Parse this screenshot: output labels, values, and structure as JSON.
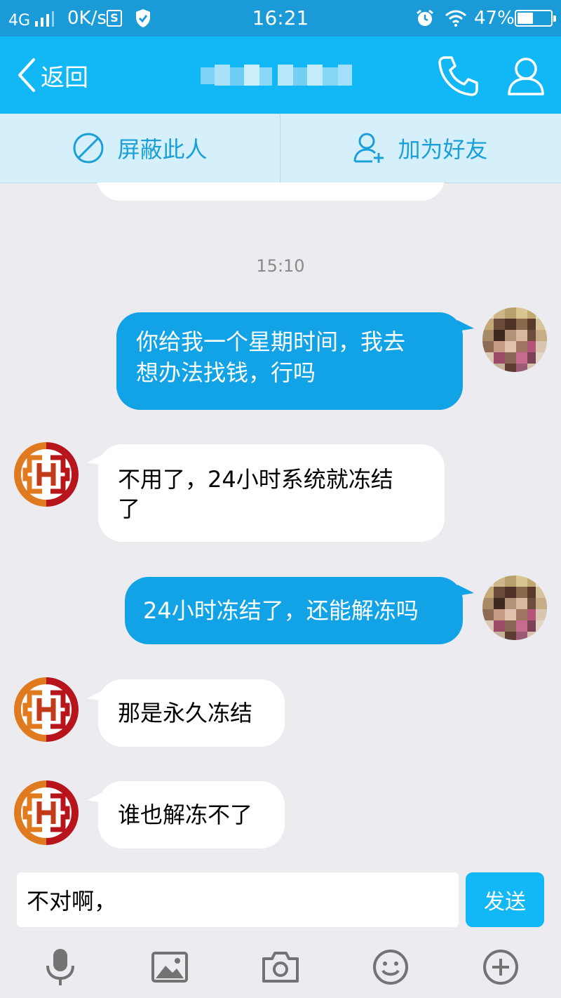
{
  "status_bar": {
    "network": "4G",
    "speed": "0K/s",
    "s_badge": "S",
    "time": "16:21",
    "battery": "47%",
    "battery_level": 0.47,
    "icons": [
      "signal-icon",
      "s-icon",
      "shield-icon",
      "alarm-icon",
      "wifi-icon",
      "battery-icon"
    ]
  },
  "header": {
    "back_label": "返回",
    "title_redacted": true,
    "icons": [
      "back-chevron-icon",
      "phone-icon",
      "profile-icon"
    ]
  },
  "actions": {
    "block_label": "屏蔽此人",
    "add_friend_label": "加为好友",
    "icons": [
      "block-icon",
      "add-friend-icon"
    ]
  },
  "chat": {
    "timestamp": "15:10",
    "messages": [
      {
        "sender": "me",
        "lines": [
          "你给我一个星期时间，我去",
          "想办法找钱，行吗"
        ]
      },
      {
        "sender": "them",
        "lines": [
          "不用了，24小时系统就冻结",
          "了"
        ]
      },
      {
        "sender": "me",
        "lines": [
          "24小时冻结了，还能解冻吗"
        ]
      },
      {
        "sender": "them",
        "lines": [
          "那是永久冻结"
        ]
      },
      {
        "sender": "them",
        "lines": [
          "谁也解冻不了"
        ]
      }
    ]
  },
  "composer": {
    "value": "不对啊，",
    "send_label": "发送"
  },
  "toolbar": {
    "icons": [
      "microphone-icon",
      "image-icon",
      "camera-icon",
      "emoji-icon",
      "plus-icon"
    ]
  },
  "colors": {
    "status_bar": "#1a9bd8",
    "title_bar": "#12b7f5",
    "action_bar": "#d6f0fb",
    "action_text": "#1a9fd9",
    "my_bubble": "#12a3e6",
    "their_bubble": "#ffffff",
    "chat_background": "#ebebf0",
    "logo_orange": "#e07a1e",
    "logo_red": "#b8141c"
  }
}
